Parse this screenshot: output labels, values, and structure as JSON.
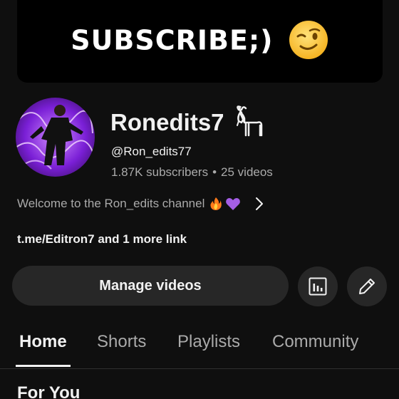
{
  "banner": {
    "text": "SUBSCRIBE;)",
    "emoji": "winking-face-emoji"
  },
  "channel": {
    "name": "Ronedits7",
    "name_emoji": "goat-icon",
    "handle": "@Ron_edits77",
    "subscribers": "1.87K subscribers",
    "separator": "•",
    "videos": "25 videos",
    "description": "Welcome to the Ron_edits channel",
    "description_emojis": [
      "fire-emoji",
      "purple-heart-emoji"
    ],
    "links": "t.me/Editron7 and 1 more link"
  },
  "actions": {
    "manage_label": "Manage videos",
    "analytics_icon": "analytics-icon",
    "edit_icon": "pencil-icon"
  },
  "tabs": [
    {
      "label": "Home",
      "active": true
    },
    {
      "label": "Shorts",
      "active": false
    },
    {
      "label": "Playlists",
      "active": false
    },
    {
      "label": "Community",
      "active": false
    }
  ],
  "section": {
    "title": "For You"
  },
  "colors": {
    "background": "#0f0f0f",
    "button": "#272727",
    "text_primary": "#f1f1f1",
    "text_secondary": "#aaaaaa",
    "avatar_accent": "#8a2be2"
  }
}
